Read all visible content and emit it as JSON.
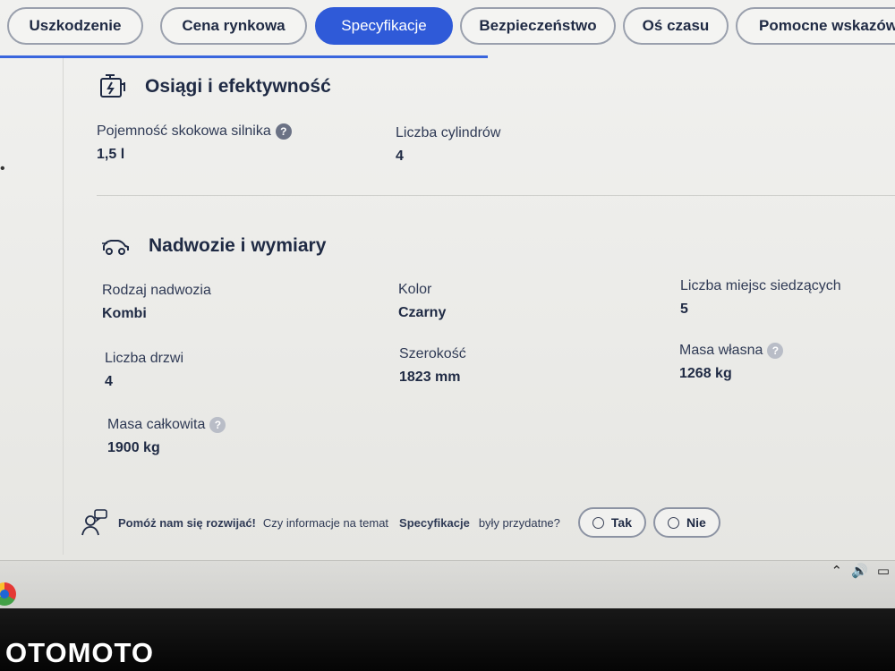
{
  "tabs": [
    {
      "label": "Uszkodzenie"
    },
    {
      "label": "Cena rynkowa"
    },
    {
      "label": "Specyfikacje"
    },
    {
      "label": "Bezpieczeństwo"
    },
    {
      "label": "Oś czasu"
    },
    {
      "label": "Pomocne wskazówki p"
    }
  ],
  "active_tab": "Specyfikacje",
  "sections": {
    "performance": {
      "title": "Osiągi i efektywność",
      "icon": "engine-icon",
      "fields": [
        {
          "label": "Pojemność skokowa silnika",
          "value": "1,5 l",
          "help": true
        },
        {
          "label": "Liczba cylindrów",
          "value": "4"
        }
      ]
    },
    "body": {
      "title": "Nadwozie i wymiary",
      "icon": "car-icon",
      "fields": [
        {
          "label": "Rodzaj nadwozia",
          "value": "Kombi"
        },
        {
          "label": "Kolor",
          "value": "Czarny"
        },
        {
          "label": "Liczba miejsc siedzących",
          "value": "5"
        },
        {
          "label": "Liczba drzwi",
          "value": "4"
        },
        {
          "label": "Szerokość",
          "value": "1823 mm"
        },
        {
          "label": "Masa własna",
          "value": "1268 kg",
          "help": true
        },
        {
          "label": "Masa całkowita",
          "value": "1900 kg",
          "help": true
        }
      ]
    }
  },
  "feedback": {
    "prompt_strong": "Pomóż nam się rozwijać!",
    "question_start": "Czy informacje na temat",
    "topic": "Specyfikacje",
    "question_end": "były przydatne?",
    "yes_label": "Tak",
    "no_label": "Nie"
  },
  "watermark": "OTOMOTO",
  "colors": {
    "accent": "#2f5ad8",
    "text": "#1f2a44",
    "background": "#ececea"
  }
}
